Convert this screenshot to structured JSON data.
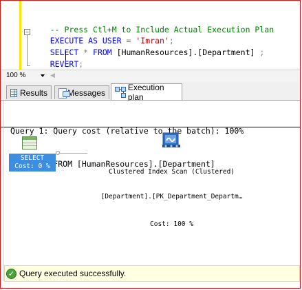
{
  "editor": {
    "lines": [
      {
        "comment": "-- Press Ctl+M to Include Actual Execution Plan"
      },
      {
        "kw1": "EXECUTE AS USER",
        "op": " = ",
        "str": "'Imran'",
        "end": ";"
      },
      {
        "kw1": "SELECT",
        "op": " * ",
        "kw2": "FROM",
        "txt": " [HumanResources].[Department] ",
        "end": ";"
      },
      {
        "kw1": "REVERT",
        "end": ";"
      }
    ]
  },
  "zoom": {
    "value": "100 %"
  },
  "tabs": [
    {
      "label": "Results",
      "icon": "grid-icon",
      "active": false
    },
    {
      "label": "Messages",
      "icon": "messages-icon",
      "active": false
    },
    {
      "label": "Execution plan",
      "icon": "execution-plan-icon",
      "active": true
    }
  ],
  "plan": {
    "query_line": "Query 1: Query cost (relative to the batch): 100%",
    "sql_line": "SELECT * FROM [HumanResources].[Department]",
    "select_node": {
      "label": "SELECT",
      "cost": "Cost: 0 %",
      "icon": "select-result-icon"
    },
    "scan_node": {
      "title": "Clustered Index Scan (Clustered)",
      "object": "[Department].[PK_Department_Departm…",
      "cost": "Cost: 100 %",
      "icon": "clustered-index-scan-icon"
    }
  },
  "status": {
    "text": "Query executed successfully.",
    "icon": "success-check-icon"
  },
  "colors": {
    "comment": "#008000",
    "keyword": "#0000ff",
    "string": "#d00000",
    "selection": "#3d8ee0",
    "status_bg": "#ffffe1",
    "gutter_marker": "#ffe600"
  }
}
